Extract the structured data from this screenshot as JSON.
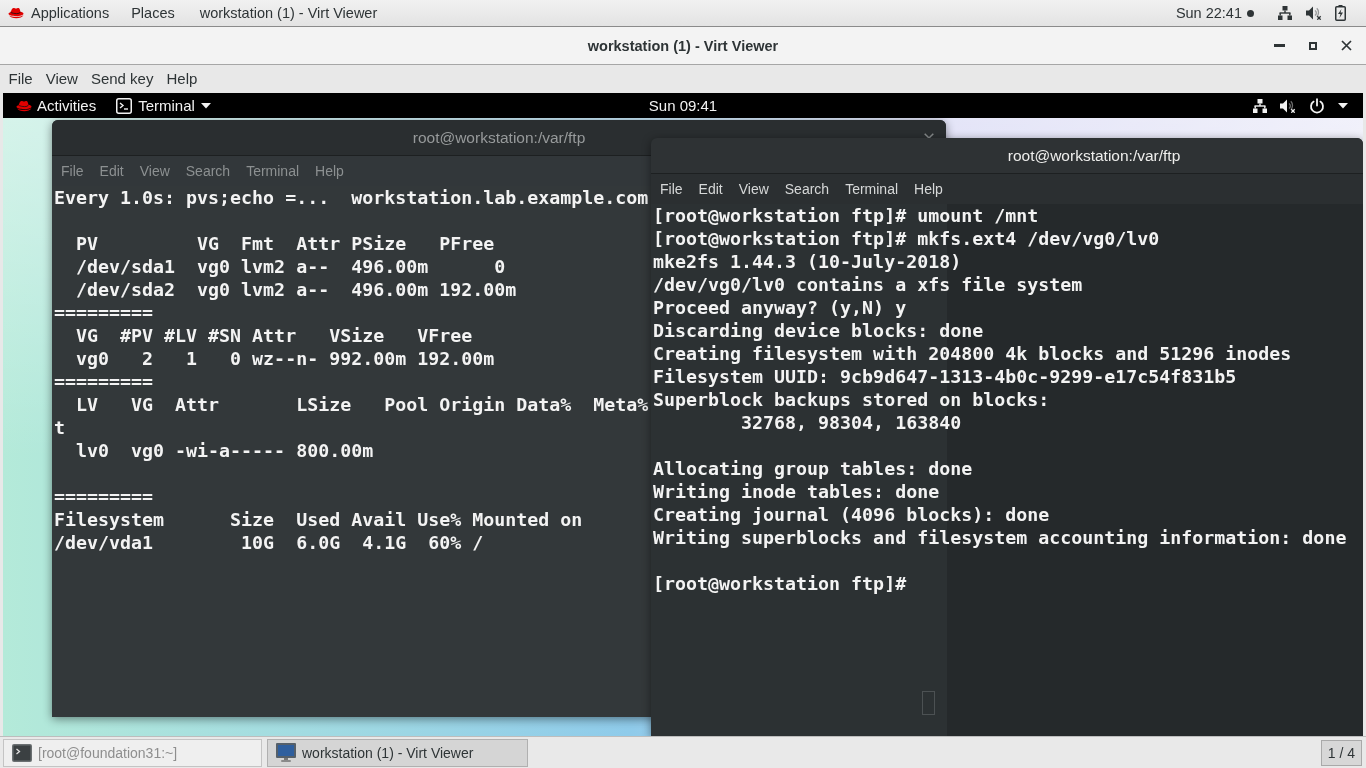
{
  "top_bar": {
    "applications": "Applications",
    "places": "Places",
    "window_menu": "workstation (1) - Virt Viewer",
    "clock": "Sun 22:41"
  },
  "window": {
    "title": "workstation (1) - Virt Viewer"
  },
  "menu": [
    "File",
    "View",
    "Send key",
    "Help"
  ],
  "guest": {
    "top_bar": {
      "activities": "Activities",
      "app_menu": "Terminal",
      "clock": "Sun 09:41"
    },
    "terminals": [
      {
        "title": "root@workstation:/var/ftp",
        "focused": false,
        "menu": [
          "File",
          "Edit",
          "View",
          "Search",
          "Terminal",
          "Help"
        ],
        "output": "Every 1.0s: pvs;echo =...  workstation.lab.example.com\n\n  PV         VG  Fmt  Attr PSize   PFree\n  /dev/sda1  vg0 lvm2 a--  496.00m      0\n  /dev/sda2  vg0 lvm2 a--  496.00m 192.00m\n=========\n  VG  #PV #LV #SN Attr   VSize   VFree\n  vg0   2   1   0 wz--n- 992.00m 192.00m\n=========\n  LV   VG  Attr       LSize   Pool Origin Data%  Meta%\nt\n  lv0  vg0 -wi-a----- 800.00m\n\n=========\nFilesystem      Size  Used Avail Use% Mounted on\n/dev/vda1        10G  6.0G  4.1G  60% /"
      },
      {
        "title": "root@workstation:/var/ftp",
        "focused": true,
        "menu": [
          "File",
          "Edit",
          "View",
          "Search",
          "Terminal",
          "Help"
        ],
        "output": "[root@workstation ftp]# umount /mnt\n[root@workstation ftp]# mkfs.ext4 /dev/vg0/lv0\nmke2fs 1.44.3 (10-July-2018)\n/dev/vg0/lv0 contains a xfs file system\nProceed anyway? (y,N) y\nDiscarding device blocks: done\nCreating filesystem with 204800 4k blocks and 51296 inodes\nFilesystem UUID: 9cb9d647-1313-4b0c-9299-e17c54f831b5\nSuperblock backups stored on blocks:\n        32768, 98304, 163840\n\nAllocating group tables: done\nWriting inode tables: done\nCreating journal (4096 blocks): done\nWriting superblocks and filesystem accounting information: done\n\n[root@workstation ftp]#"
      }
    ]
  },
  "taskbar": {
    "items": [
      {
        "kind": "terminal",
        "label": "[root@foundation31:~]",
        "selected": false
      },
      {
        "kind": "viewer",
        "label": "workstation (1) - Virt Viewer",
        "selected": true
      }
    ],
    "workspace": "1 / 4"
  }
}
